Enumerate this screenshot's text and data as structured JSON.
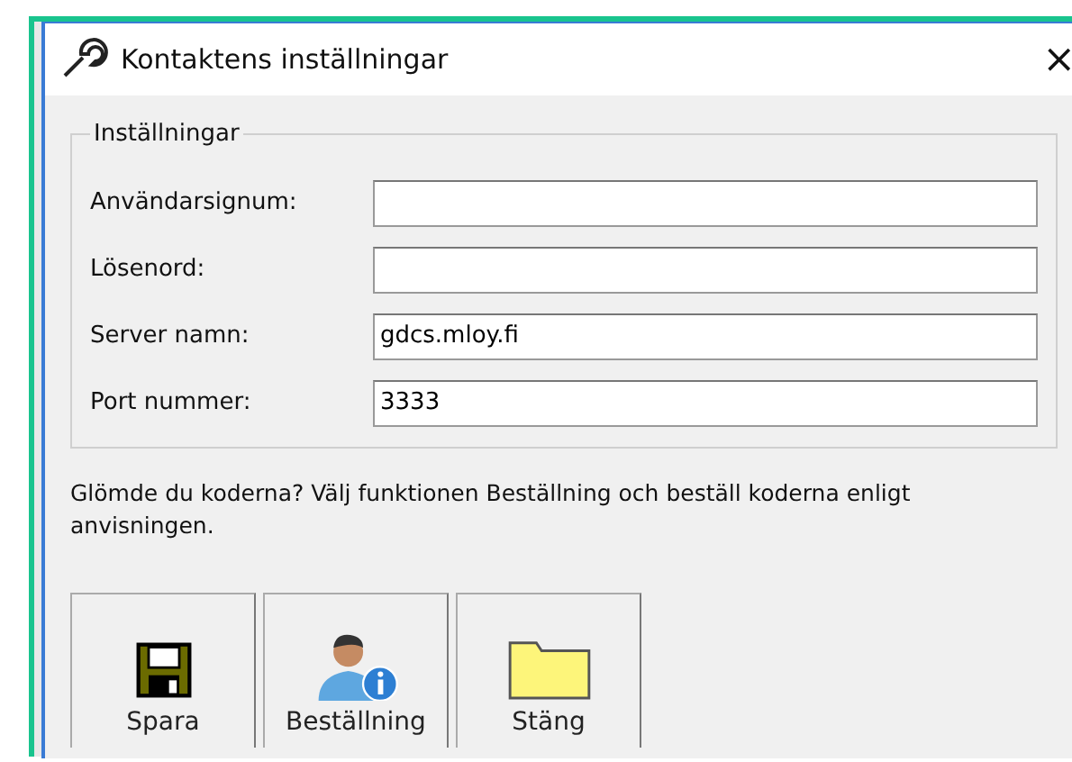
{
  "window": {
    "title": "Kontaktens inställningar",
    "close": "×"
  },
  "group": {
    "title": "Inställningar",
    "fields": [
      {
        "label": "Användarsignum:"
      },
      {
        "label": "Lösenord:"
      },
      {
        "label": "Server namn:",
        "value": "gdcs.mloy.fi"
      },
      {
        "label": "Port nummer:",
        "value": "3333"
      }
    ]
  },
  "hint": "Glömde du koderna? Välj funktionen Beställning och beställ koderna enligt anvisningen.",
  "buttons": [
    {
      "kind": "save",
      "label": "Spara"
    },
    {
      "kind": "order",
      "label": "Beställning"
    },
    {
      "kind": "close",
      "label": "Stäng"
    }
  ]
}
